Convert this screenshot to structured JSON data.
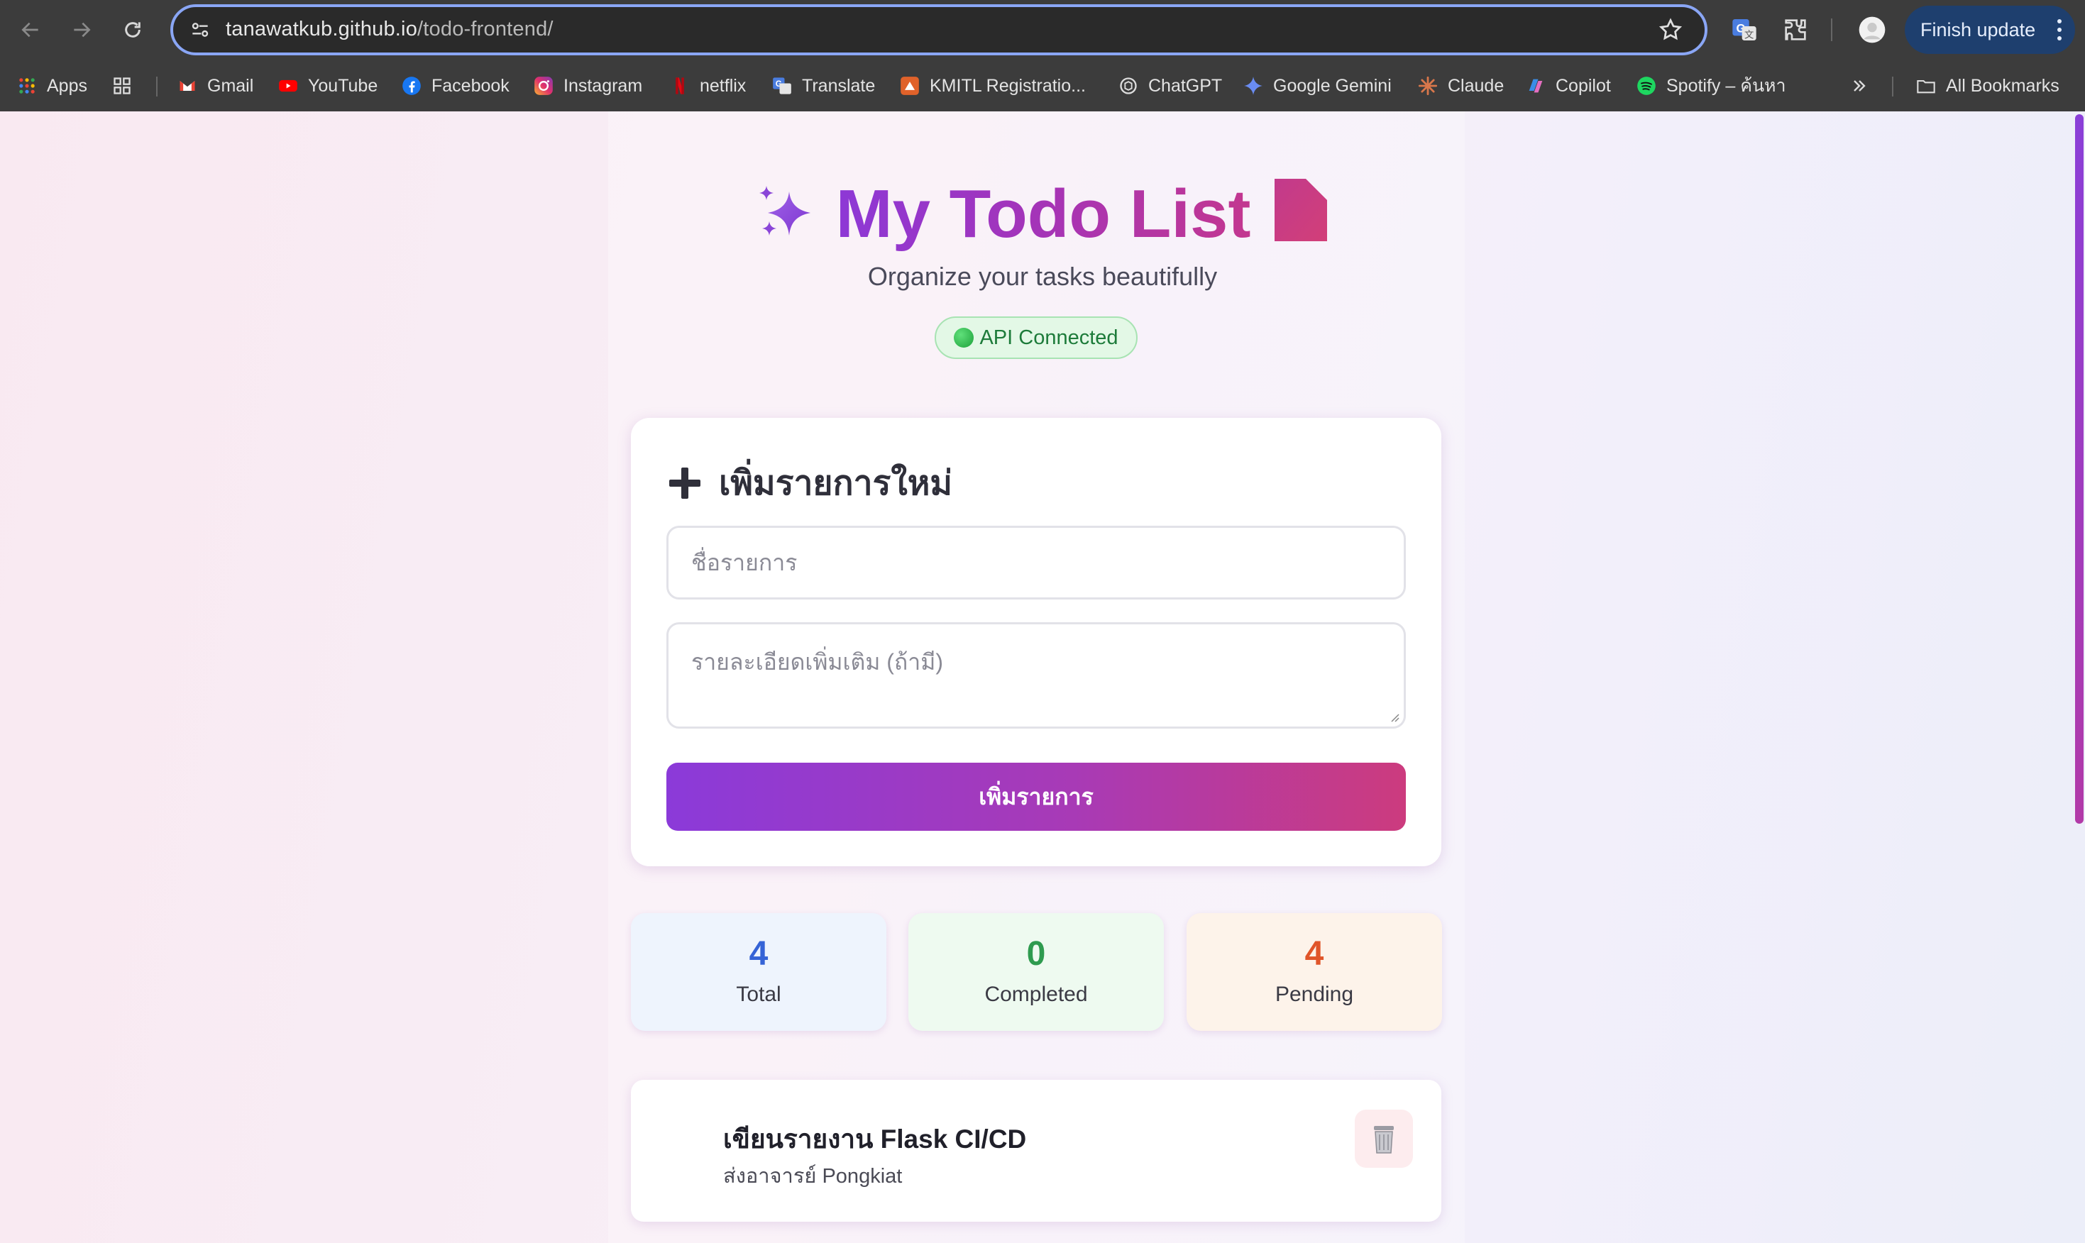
{
  "browser": {
    "url_host": "tanawatkub.github.io",
    "url_path": "/todo-frontend/",
    "finish_update_label": "Finish update",
    "bookmarks": [
      {
        "label": "Apps",
        "icon": "apps-grid-icon"
      },
      {
        "label": "Gmail",
        "icon": "gmail-icon"
      },
      {
        "label": "YouTube",
        "icon": "youtube-icon"
      },
      {
        "label": "Facebook",
        "icon": "facebook-icon"
      },
      {
        "label": "Instagram",
        "icon": "instagram-icon"
      },
      {
        "label": "netflix",
        "icon": "netflix-icon"
      },
      {
        "label": "Translate",
        "icon": "translate-icon"
      },
      {
        "label": "KMITL Registratio...",
        "icon": "kmitl-icon"
      },
      {
        "label": "ChatGPT",
        "icon": "chatgpt-icon"
      },
      {
        "label": "Google Gemini",
        "icon": "gemini-icon"
      },
      {
        "label": "Claude",
        "icon": "claude-icon"
      },
      {
        "label": "Copilot",
        "icon": "copilot-icon"
      },
      {
        "label": "Spotify – ค้นหา",
        "icon": "spotify-icon"
      }
    ],
    "all_bookmarks_label": "All Bookmarks"
  },
  "app": {
    "title": "My Todo List",
    "subtitle": "Organize your tasks beautifully",
    "api_status": "API Connected"
  },
  "form": {
    "heading": "เพิ่มรายการใหม่",
    "title_placeholder": "ชื่อรายการ",
    "description_placeholder": "รายละเอียดเพิ่มเติม (ถ้ามี)",
    "submit_label": "เพิ่มรายการ"
  },
  "stats": {
    "total": {
      "value": "4",
      "label": "Total",
      "color": "#3563d6"
    },
    "completed": {
      "value": "0",
      "label": "Completed",
      "color": "#2e9b4f"
    },
    "pending": {
      "value": "4",
      "label": "Pending",
      "color": "#e0552a"
    }
  },
  "todos": [
    {
      "title": "เขียนรายงาน Flask CI/CD",
      "description": "ส่งอาจารย์ Pongkiat"
    }
  ],
  "colors": {
    "accent_purple": "#8d38d6",
    "accent_pink": "#c3378f",
    "api_green": "#1d7b3a"
  }
}
